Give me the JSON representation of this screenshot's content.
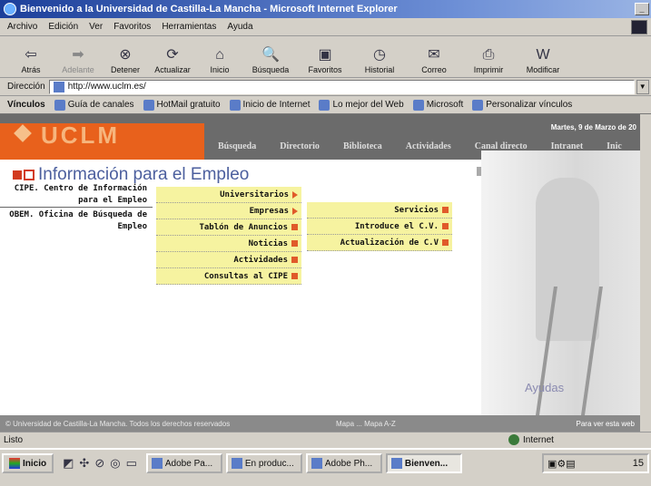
{
  "window": {
    "title": "Bienvenido a la Universidad de Castilla-La Mancha - Microsoft Internet Explorer"
  },
  "menu": [
    "Archivo",
    "Edición",
    "Ver",
    "Favoritos",
    "Herramientas",
    "Ayuda"
  ],
  "toolbar": [
    {
      "label": "Atrás",
      "icon": "back-arrow-icon"
    },
    {
      "label": "Adelante",
      "icon": "forward-arrow-icon"
    },
    {
      "label": "Detener",
      "icon": "stop-icon"
    },
    {
      "label": "Actualizar",
      "icon": "refresh-icon"
    },
    {
      "label": "Inicio",
      "icon": "home-icon"
    },
    {
      "label": "Búsqueda",
      "icon": "search-icon"
    },
    {
      "label": "Favoritos",
      "icon": "favorites-icon"
    },
    {
      "label": "Historial",
      "icon": "history-icon"
    },
    {
      "label": "Correo",
      "icon": "mail-icon"
    },
    {
      "label": "Imprimir",
      "icon": "print-icon"
    },
    {
      "label": "Modificar",
      "icon": "edit-icon"
    }
  ],
  "address": {
    "label": "Dirección",
    "url": "http://www.uclm.es/"
  },
  "links": {
    "label": "Vínculos",
    "items": [
      "Guía de canales",
      "HotMail gratuito",
      "Inicio de Internet",
      "Lo mejor del Web",
      "Microsoft",
      "Personalizar vínculos"
    ]
  },
  "site": {
    "logo": "UCLM",
    "date": "Martes, 9 de Marzo de 20",
    "nav": [
      "Búsqueda",
      "Directorio",
      "Biblioteca",
      "Actividades",
      "Canal directo",
      "Intranet",
      "Inic"
    ],
    "page_title": "Información para el Empleo",
    "sidebar": [
      "CIPE. Centro de Información para el Empleo",
      "OBEM. Oficina de Búsqueda de Empleo"
    ],
    "menu1": [
      "Universitarios",
      "Empresas",
      "Tablón de Anuncios",
      "Noticias",
      "Actividades",
      "Consultas al CIPE"
    ],
    "menu2": [
      "Servicios",
      "Introduce el C.V.",
      "Actualización de C.V"
    ],
    "ayudas": "Ayudas",
    "footer_left": "© Universidad de Castilla-La Mancha. Todos los derechos reservados",
    "footer_mid": "Mapa ...  Mapa A-Z",
    "footer_right": "Para ver esta web"
  },
  "status": {
    "left": "Listo",
    "zone": "Internet"
  },
  "taskbar": {
    "start": "Inicio",
    "tasks": [
      "Adobe Pa...",
      "En produc...",
      "Adobe Ph...",
      "Bienven..."
    ],
    "clock": "15"
  }
}
